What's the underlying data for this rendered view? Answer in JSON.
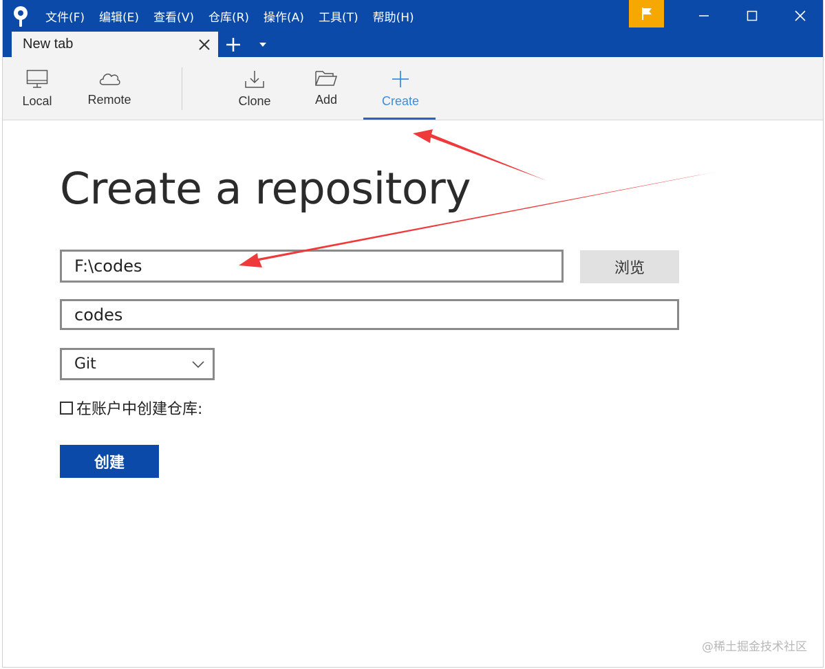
{
  "app": {
    "logo_icon": "sourcetree-logo-icon",
    "accent_color": "#0b4aa8",
    "flag_color": "#f7a800"
  },
  "menu": {
    "items": [
      "文件(F)",
      "编辑(E)",
      "查看(V)",
      "仓库(R)",
      "操作(A)",
      "工具(T)",
      "帮助(H)"
    ]
  },
  "tabs": {
    "items": [
      {
        "label": "New tab"
      }
    ],
    "add_icon": "plus-icon",
    "dropdown_icon": "caret-down-icon"
  },
  "toolbar": {
    "local": {
      "label": "Local",
      "icon": "monitor-icon"
    },
    "remote": {
      "label": "Remote",
      "icon": "cloud-icon"
    },
    "clone": {
      "label": "Clone",
      "icon": "download-icon"
    },
    "add": {
      "label": "Add",
      "icon": "folder-open-icon"
    },
    "create": {
      "label": "Create",
      "icon": "plus-icon",
      "active": true
    }
  },
  "form": {
    "title": "Create a repository",
    "path_value": "F:\\codes",
    "browse_label": "浏览",
    "name_value": "codes",
    "vcs_selected": "Git",
    "account_checkbox_label": "在账户中创建仓库:",
    "account_checkbox_checked": false,
    "create_label": "创建"
  },
  "watermark": "@稀土掘金技术社区"
}
